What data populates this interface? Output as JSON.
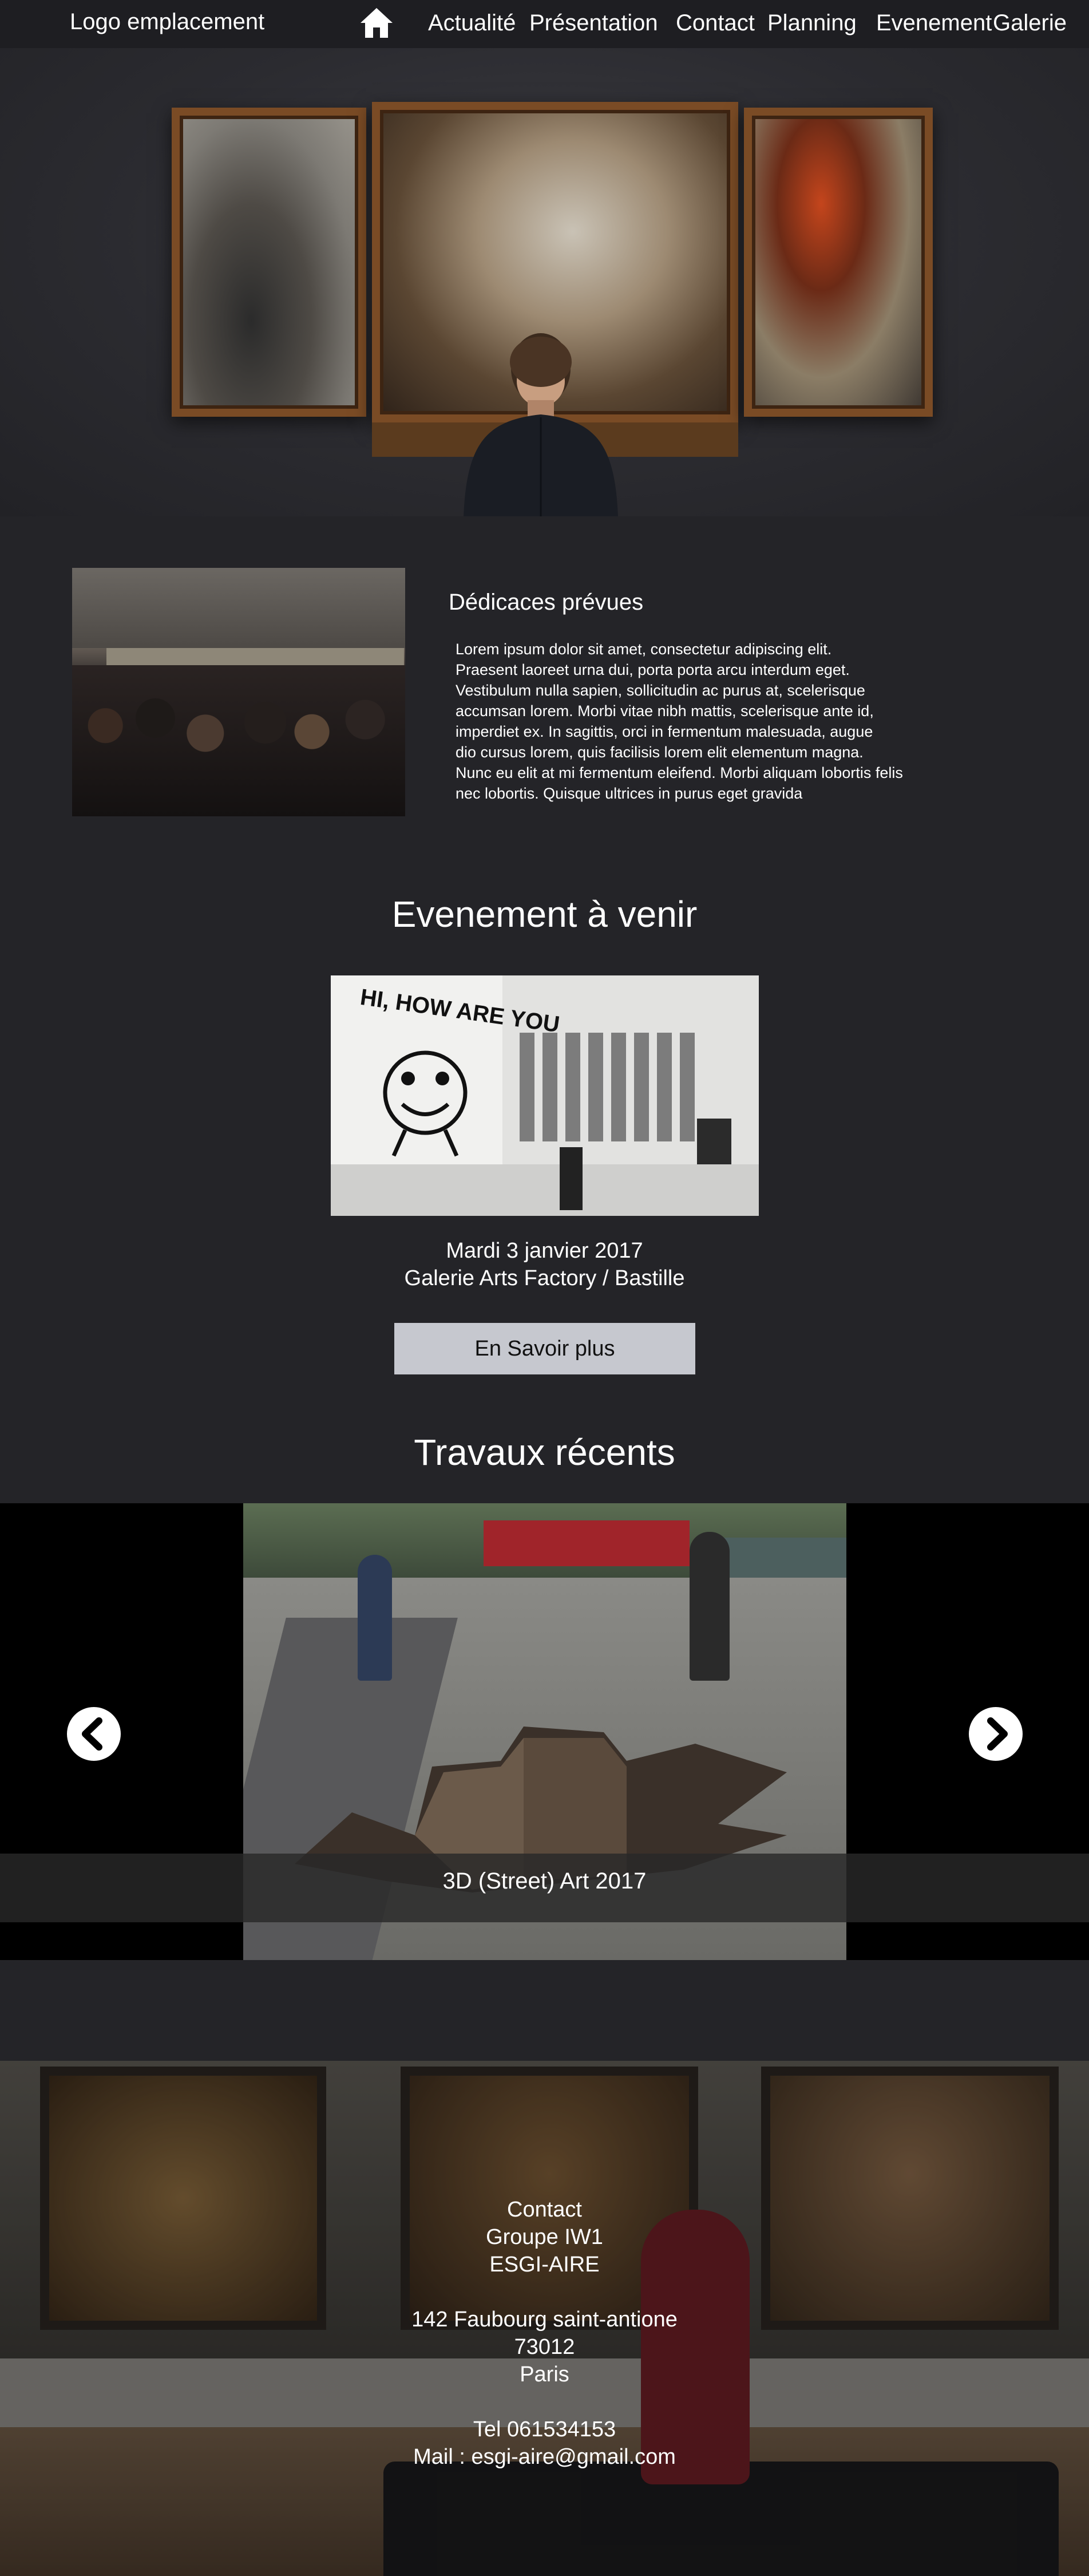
{
  "nav": {
    "logo": "Logo emplacement",
    "items": [
      "Actualité",
      "Présentation",
      "Contact",
      "Planning",
      "Evenement",
      "Galerie"
    ]
  },
  "dedicaces": {
    "title": "Dédicaces prévues",
    "lines": [
      " Lorem ipsum dolor sit amet, consectetur adipiscing elit.",
      "Praesent laoreet urna dui, porta porta arcu interdum eget.",
      "Vestibulum nulla sapien, sollicitudin ac purus at, scelerisque",
      "accumsan lorem. Morbi vitae nibh mattis, scelerisque ante id,",
      "imperdiet ex. In sagittis, orci in fermentum malesuada, augue",
      "dio cursus lorem, quis facilisis lorem elit elementum magna.",
      "Nunc eu elit at mi fermentum eleifend. Morbi aliquam lobortis felis",
      "nec lobortis. Quisque ultrices in purus eget gravida"
    ]
  },
  "evenement": {
    "title": "Evenement à venir",
    "date": "Mardi 3 janvier 2017",
    "location": "Galerie Arts Factory / Bastille",
    "button_label": "En Savoir plus",
    "wall_text": "HI, HOW ARE YOU"
  },
  "travaux": {
    "title": "Travaux récents",
    "slide_caption": "3D (Street) Art 2017"
  },
  "footer": {
    "lines": [
      "Contact",
      "Groupe IW1",
      "ESGI-AIRE",
      "",
      "142 Faubourg saint-antione",
      "73012",
      "Paris",
      "",
      "Tel 061534153",
      "Mail : esgi-aire@gmail.com"
    ]
  },
  "colors": {
    "background": "#242428",
    "nav_background": "#1e1e22",
    "button": "#c6c8cf",
    "frame": "#7a4b25"
  },
  "icons": [
    "home-icon",
    "arrow-left-icon",
    "arrow-right-icon"
  ]
}
